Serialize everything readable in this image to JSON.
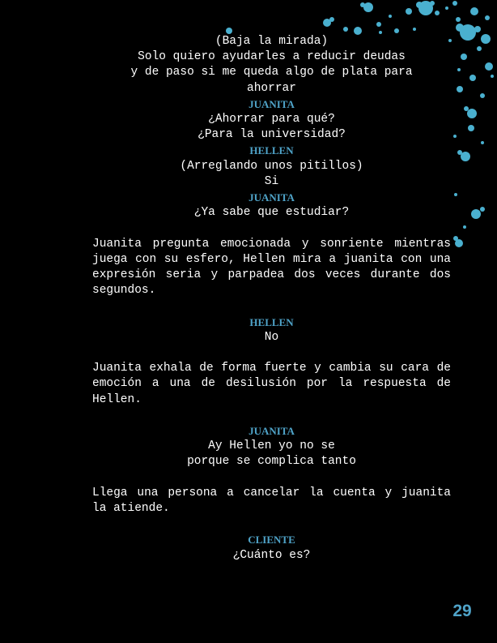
{
  "script": {
    "block1": {
      "paren1": "(Baja la mirada)",
      "line1": "Solo quiero ayudarles a reducir deudas",
      "line2": "y de paso si me queda algo de plata para",
      "line3": "ahorrar"
    },
    "block2": {
      "character": "JUANITA",
      "line1": "¿Ahorrar para qué?",
      "line2": "¿Para la universidad?"
    },
    "block3": {
      "character": "HELLEN",
      "paren": "(Arreglando unos pitillos)",
      "line1": "Si"
    },
    "block4": {
      "character": "JUANITA",
      "line1": "¿Ya sabe que estudiar?"
    },
    "action1": "Juanita pregunta emocionada y sonriente mientras juega con su esfero, Hellen mira a juanita con una expresión seria y parpadea dos veces durante dos segundos.",
    "block5": {
      "character": "HELLEN",
      "line1": "No"
    },
    "action2": "Juanita exhala de forma fuerte y cambia su cara de emoción a una de desilusión por la respuesta de Hellen.",
    "block6": {
      "character": "JUANITA",
      "line1": "Ay Hellen yo no se",
      "line2": "porque se complica tanto"
    },
    "action3": "Llega una persona a cancelar la cuenta y juanita la atiende.",
    "block7": {
      "character": "CLIENTE",
      "line1": "¿Cuánto es?"
    }
  },
  "page_number": "29",
  "colors": {
    "background": "#000000",
    "text": "#ffffff",
    "accent": "#4fa3c8",
    "splatter": "#4ab0cf"
  },
  "decoration": "paint-splatter-top-right"
}
